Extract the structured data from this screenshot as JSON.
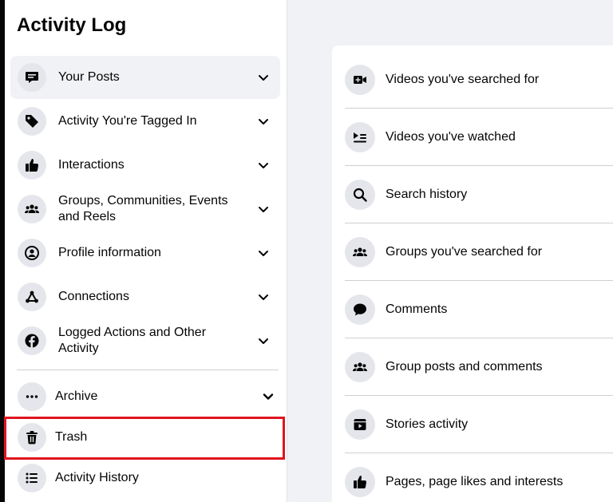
{
  "sidebar": {
    "title": "Activity Log",
    "items": [
      {
        "label": "Your Posts",
        "icon": "posts-icon"
      },
      {
        "label": "Activity You're Tagged In",
        "icon": "tag-icon"
      },
      {
        "label": "Interactions",
        "icon": "thumbs-up-icon"
      },
      {
        "label": "Groups, Communities, Events and Reels",
        "icon": "groups-icon"
      },
      {
        "label": "Profile information",
        "icon": "profile-icon"
      },
      {
        "label": "Connections",
        "icon": "connections-icon"
      },
      {
        "label": "Logged Actions and Other Activity",
        "icon": "facebook-icon"
      }
    ],
    "archive_label": "Archive",
    "trash_label": "Trash",
    "history_label": "Activity History",
    "highlight_color": "#e0141e"
  },
  "panel": {
    "rows": [
      {
        "label": "Videos you've searched for",
        "icon": "video-camera-icon"
      },
      {
        "label": "Videos you've watched",
        "icon": "video-list-icon"
      },
      {
        "label": "Search history",
        "icon": "search-icon"
      },
      {
        "label": "Groups you've searched for",
        "icon": "groups-icon"
      },
      {
        "label": "Comments",
        "icon": "comment-icon"
      },
      {
        "label": "Group posts and comments",
        "icon": "groups-icon"
      },
      {
        "label": "Stories activity",
        "icon": "stories-icon"
      },
      {
        "label": "Pages, page likes and interests",
        "icon": "thumbs-up-icon"
      }
    ]
  }
}
